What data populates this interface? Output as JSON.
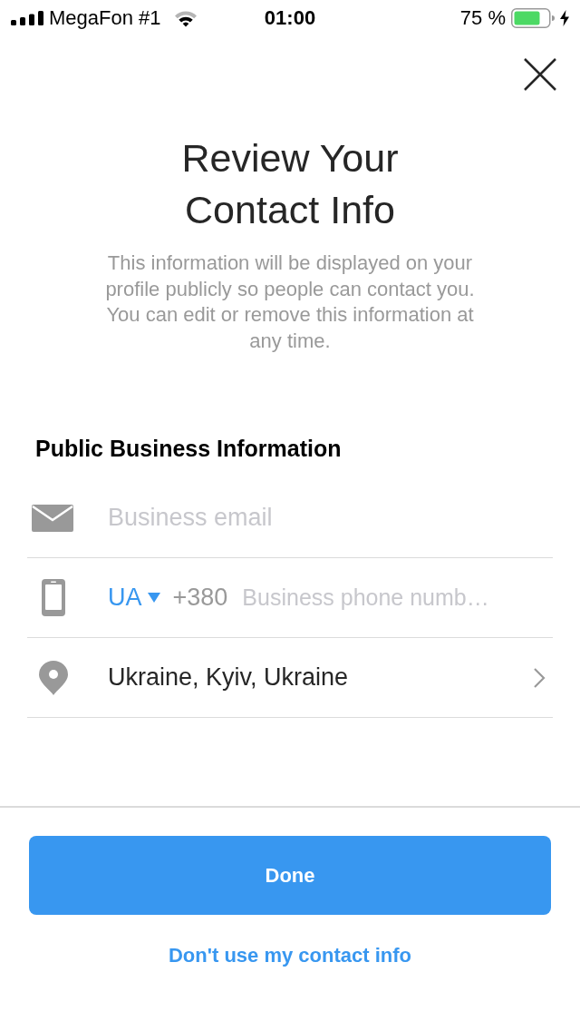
{
  "status_bar": {
    "carrier": "MegaFon #1",
    "time": "01:00",
    "battery": "75 %",
    "charging": true
  },
  "title": "Review Your Contact Info",
  "description": "This information will be displayed on your profile publicly so people can contact you. You can edit or remove this information at any time.",
  "section_title": "Public Business Information",
  "fields": [
    {
      "kind": "email",
      "placeholder": "Business email"
    },
    {
      "kind": "phone",
      "country_code": "UA",
      "dial_code": "+380",
      "placeholder": "Business phone numb…"
    },
    {
      "kind": "location",
      "value": "Ukraine, Kyiv, Ukraine"
    }
  ],
  "primary_button": "Done",
  "secondary_link": "Don't use my contact info"
}
